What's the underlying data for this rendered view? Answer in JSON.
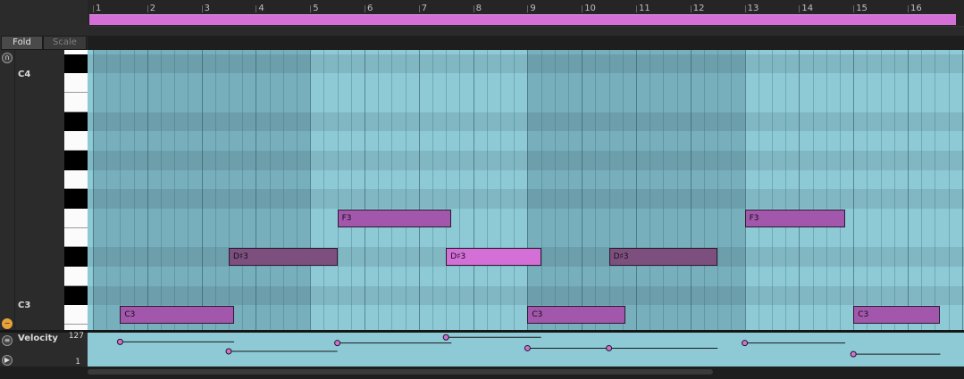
{
  "ruler": {
    "bars": [
      "1",
      "2",
      "3",
      "4",
      "5",
      "6",
      "7",
      "8",
      "9",
      "10",
      "11",
      "12",
      "13",
      "14",
      "15",
      "16"
    ]
  },
  "left": {
    "fold_label": "Fold",
    "scale_label": "Scale",
    "octave_high": "C4",
    "octave_low": "C3"
  },
  "notes": [
    {
      "label": "C3",
      "start": 1.5,
      "length": 2.1,
      "pitch": "C3",
      "selected": false
    },
    {
      "label": "D♯3",
      "start": 3.5,
      "length": 2.0,
      "pitch": "D#3",
      "selected": false
    },
    {
      "label": "F3",
      "start": 5.5,
      "length": 2.1,
      "pitch": "F3",
      "selected": false
    },
    {
      "label": "D♯3",
      "start": 7.5,
      "length": 1.75,
      "pitch": "D#3",
      "selected": true
    },
    {
      "label": "C3",
      "start": 9.0,
      "length": 1.8,
      "pitch": "C3",
      "selected": false
    },
    {
      "label": "D♯3",
      "start": 10.5,
      "length": 2.0,
      "pitch": "D#3",
      "selected": false
    },
    {
      "label": "F3",
      "start": 13.0,
      "length": 1.85,
      "pitch": "F3",
      "selected": false
    },
    {
      "label": "C3",
      "start": 15.0,
      "length": 1.6,
      "pitch": "C3",
      "selected": false
    }
  ],
  "velocity": {
    "title": "Velocity",
    "max": "127",
    "min": "1",
    "values": [
      0.8,
      0.47,
      0.76,
      0.96,
      0.58,
      0.58,
      0.76,
      0.37
    ]
  },
  "colors": {
    "note": "#a357ac",
    "note_dark": "#7d4f7f",
    "note_selected": "#d36fd7",
    "grid": "#8dcad6",
    "grid_band": "#77afbc"
  }
}
